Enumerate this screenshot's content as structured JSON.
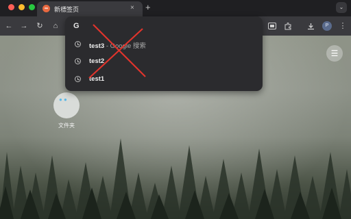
{
  "colors": {
    "close": "#ff5f57",
    "minimize": "#febc2e",
    "maximize": "#28c840",
    "annotation_x": "#e0342c"
  },
  "tab": {
    "title": "新標签页",
    "favicon": "∞",
    "close": "×"
  },
  "new_tab": "+",
  "tab_menu": "⌄",
  "toolbar": {
    "back": "←",
    "forward": "→",
    "reload": "↻",
    "home": "⌂",
    "menu": "⋮",
    "avatar": "P"
  },
  "omnibox": {
    "engine_letter": "G",
    "suggestions": [
      {
        "text": "test3",
        "hint": " - Google 搜索"
      },
      {
        "text": "test2",
        "hint": ""
      },
      {
        "text": "test1",
        "hint": ""
      }
    ]
  },
  "newtab_page": {
    "folder_label": "文件夹",
    "folder_glyph": "● ●",
    "side_menu": "☰"
  }
}
